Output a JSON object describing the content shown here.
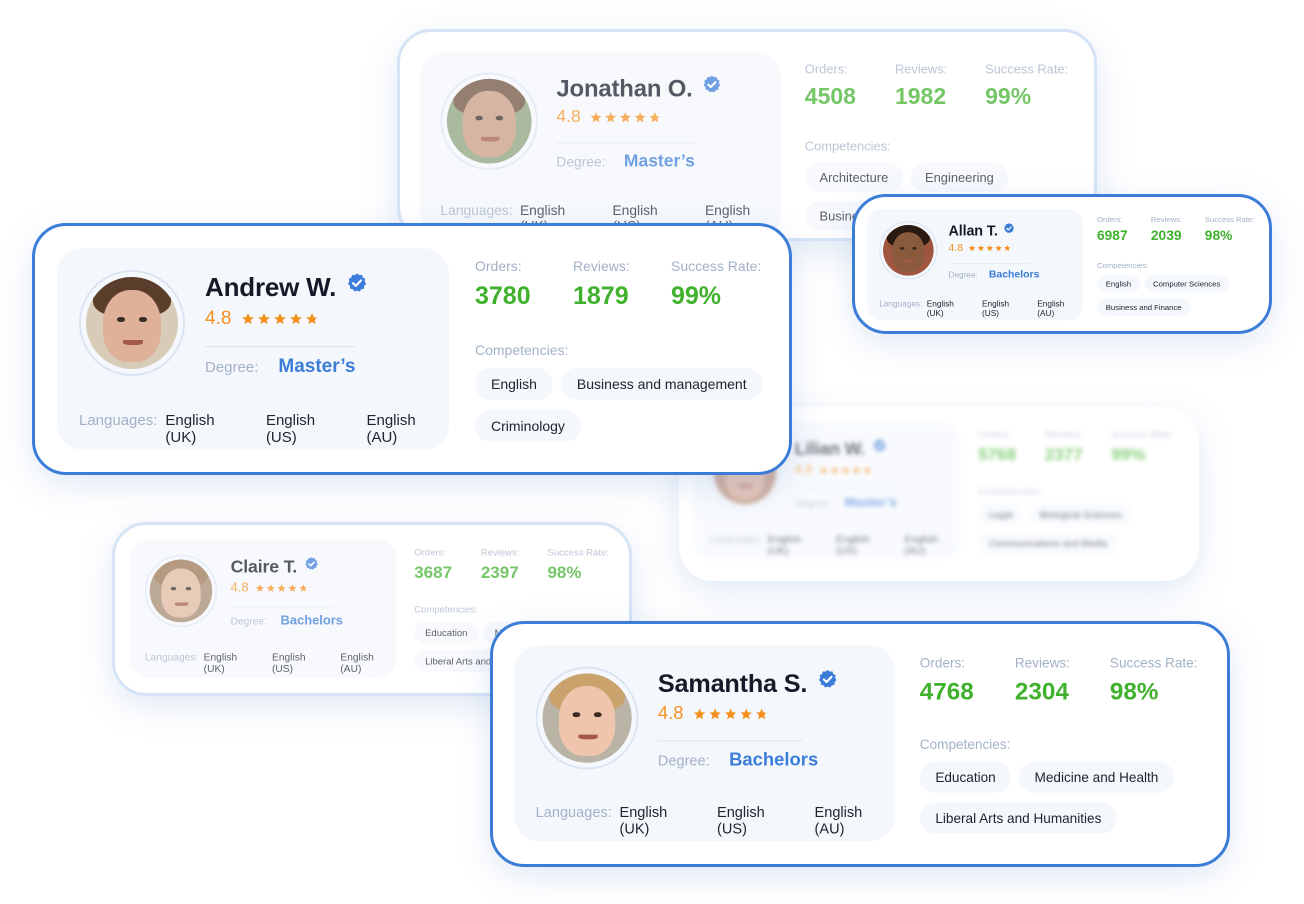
{
  "labels": {
    "degree": "Degree:",
    "languages": "Languages:",
    "orders": "Orders:",
    "reviews": "Reviews:",
    "success_rate": "Success Rate:",
    "competencies": "Competencies:"
  },
  "colors": {
    "accent_blue": "#3b7dd8",
    "stat_green": "#3fb12c",
    "rating_orange": "#f5901e",
    "muted_label": "#a3b1c6",
    "panel_bg": "#f4f8fd"
  },
  "cards": [
    {
      "id": "jonathan",
      "name": "Jonathan O.",
      "verified": true,
      "rating": "4.8",
      "stars": 4.8,
      "degree": "Master’s",
      "languages": [
        "English (UK)",
        "English (US)",
        "English (AU)"
      ],
      "orders": "4508",
      "reviews": "1982",
      "success_rate": "99%",
      "competencies": [
        "Architecture",
        "Engineering",
        "Business"
      ],
      "state": "faded"
    },
    {
      "id": "allan",
      "name": "Allan T.",
      "verified": true,
      "rating": "4.8",
      "stars": 4.8,
      "degree": "Bachelors",
      "languages": [
        "English (UK)",
        "English (US)",
        "English (AU)"
      ],
      "orders": "6987",
      "reviews": "2039",
      "success_rate": "98%",
      "competencies": [
        "English",
        "Computer Sciences",
        "Business and Finance"
      ],
      "state": "active"
    },
    {
      "id": "andrew",
      "name": "Andrew W.",
      "verified": true,
      "rating": "4.8",
      "stars": 4.8,
      "degree": "Master’s",
      "languages": [
        "English (UK)",
        "English (US)",
        "English (AU)"
      ],
      "orders": "3780",
      "reviews": "1879",
      "success_rate": "99%",
      "competencies": [
        "English",
        "Business and management",
        "Criminology"
      ],
      "state": "active"
    },
    {
      "id": "lilian",
      "name": "Lilian W.",
      "verified": true,
      "rating": "4.8",
      "stars": 4.8,
      "degree": "Master’s",
      "languages": [
        "English (UK)",
        "English (US)",
        "English (AU)"
      ],
      "orders": "5768",
      "reviews": "2377",
      "success_rate": "99%",
      "competencies": [
        "Legal",
        "Biological Sciences",
        "Communications and Media"
      ],
      "state": "blurred"
    },
    {
      "id": "claire",
      "name": "Claire T.",
      "verified": true,
      "rating": "4.8",
      "stars": 4.8,
      "degree": "Bachelors",
      "languages": [
        "English (UK)",
        "English (US)",
        "English (AU)"
      ],
      "orders": "3687",
      "reviews": "2397",
      "success_rate": "98%",
      "competencies": [
        "Education",
        "Medicine and Health",
        "Liberal Arts and Humanities"
      ],
      "state": "faded"
    },
    {
      "id": "samantha",
      "name": "Samantha S.",
      "verified": true,
      "rating": "4.8",
      "stars": 4.8,
      "degree": "Bachelors",
      "languages": [
        "English (UK)",
        "English (US)",
        "English (AU)"
      ],
      "orders": "4768",
      "reviews": "2304",
      "success_rate": "98%",
      "competencies": [
        "Education",
        "Medicine and Health",
        "Liberal Arts and Humanities"
      ],
      "state": "active"
    }
  ]
}
